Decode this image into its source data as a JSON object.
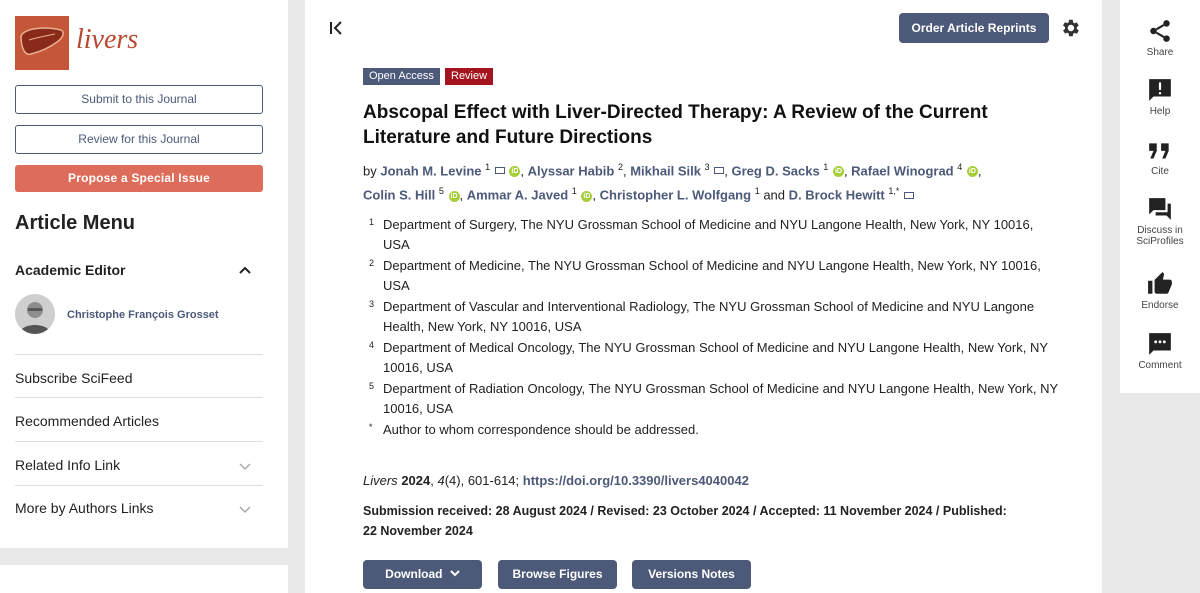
{
  "sidebar": {
    "logo_text": "livers",
    "submit_label": "Submit to this Journal",
    "review_label": "Review for this Journal",
    "propose_label": "Propose a Special Issue",
    "menu_title": "Article Menu",
    "academic_editor_label": "Academic Editor",
    "editor_name": "Christophe François Grosset",
    "links": [
      "Subscribe SciFeed",
      "Recommended Articles",
      "Related Info Link",
      "More by Authors Links"
    ]
  },
  "header": {
    "order_reprints": "Order Article Reprints"
  },
  "article": {
    "badge_open_access": "Open Access",
    "badge_type": "Review",
    "title": "Abscopal Effect with Liver-Directed Therapy: A Review of the Current Literature and Future Directions",
    "by": "by",
    "authors": [
      {
        "name": "Jonah M. Levine",
        "sup": "1"
      },
      {
        "name": "Alyssar Habib",
        "sup": "2"
      },
      {
        "name": "Mikhail Silk",
        "sup": "3"
      },
      {
        "name": "Greg D. Sacks",
        "sup": "1"
      },
      {
        "name": "Rafael Winograd",
        "sup": "4"
      },
      {
        "name": "Colin S. Hill",
        "sup": "5"
      },
      {
        "name": "Ammar A. Javed",
        "sup": "1"
      },
      {
        "name": "Christopher L. Wolfgang",
        "sup": "1"
      },
      {
        "name": "D. Brock Hewitt",
        "sup": "1,*"
      }
    ],
    "and_word": "and",
    "affiliations": [
      {
        "num": "1",
        "text": "Department of Surgery, The NYU Grossman School of Medicine and NYU Langone Health, New York, NY 10016, USA"
      },
      {
        "num": "2",
        "text": "Department of Medicine, The NYU Grossman School of Medicine and NYU Langone Health, New York, NY 10016, USA"
      },
      {
        "num": "3",
        "text": "Department of Vascular and Interventional Radiology, The NYU Grossman School of Medicine and NYU Langone Health, New York, NY 10016, USA"
      },
      {
        "num": "4",
        "text": "Department of Medical Oncology, The NYU Grossman School of Medicine and NYU Langone Health, New York, NY 10016, USA"
      },
      {
        "num": "5",
        "text": "Department of Radiation Oncology, The NYU Grossman School of Medicine and NYU Langone Health, New York, NY 10016, USA"
      },
      {
        "num": "*",
        "text": "Author to whom correspondence should be addressed."
      }
    ],
    "citation": {
      "journal": "Livers",
      "year": "2024",
      "volume": "4",
      "issue_pages": "(4), 601-614;",
      "doi": "https://doi.org/10.3390/livers4040042"
    },
    "dates": "Submission received: 28 August 2024 / Revised: 23 October 2024 / Accepted: 11 November 2024 / Published: 22 November 2024",
    "download_label": "Download",
    "browse_label": "Browse Figures",
    "versions_label": "Versions Notes"
  },
  "rail": {
    "share": "Share",
    "help": "Help",
    "cite": "Cite",
    "discuss_line1": "Discuss in",
    "discuss_line2": "SciProfiles",
    "endorse": "Endorse",
    "comment": "Comment"
  }
}
